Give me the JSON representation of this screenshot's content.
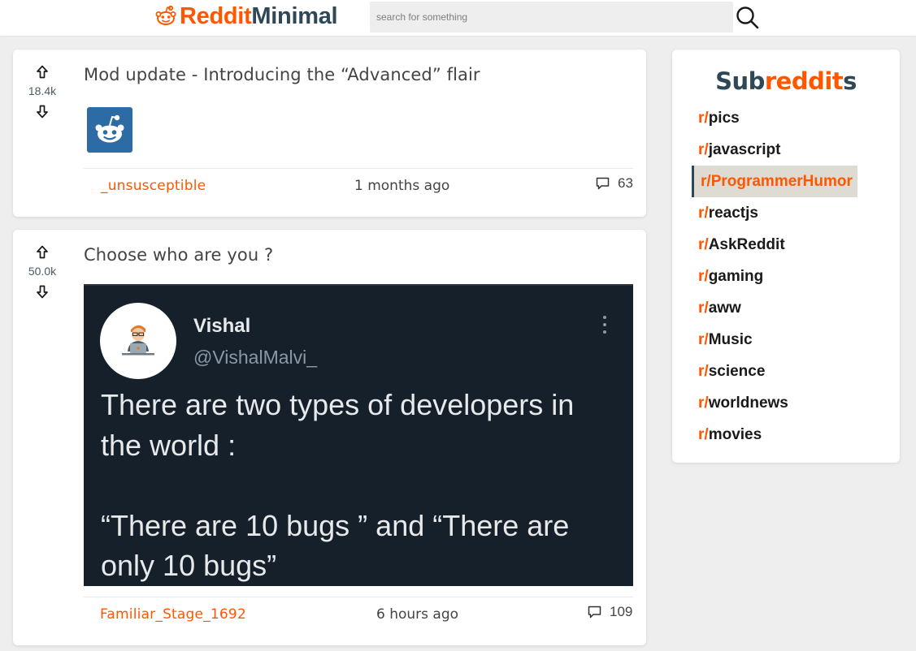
{
  "header": {
    "logo_part1": "Reddit",
    "logo_part2": "Minimal",
    "search_placeholder": "search for something"
  },
  "posts": [
    {
      "votes": "18.4k",
      "title": "Mod update - Introducing the “Advanced” flair",
      "author": "_unsusceptible",
      "time": "1 months ago",
      "comments": "63"
    },
    {
      "votes": "50.0k",
      "title": "Choose who are you ?",
      "author": "Familiar_Stage_1692",
      "time": "6 hours ago",
      "comments": "109",
      "tweet": {
        "name": "Vishal",
        "handle": "@VishalMalvi_",
        "line1": "There are two types of developers in",
        "line2": "the world :",
        "line3": "“There are 10 bugs ” and “There are",
        "line4": "only 10 bugs”"
      }
    }
  ],
  "sidebar": {
    "title_part1": "Sub",
    "title_part2": "reddit",
    "title_part3": "s",
    "prefix": "r/",
    "items": [
      "pics",
      "javascript",
      "ProgrammerHumor",
      "reactjs",
      "AskReddit",
      "gaming",
      "aww",
      "Music",
      "science",
      "worldnews",
      "movies"
    ],
    "active": "ProgrammerHumor"
  },
  "colors": {
    "brand_orange": "#ff5700",
    "brand_dark": "#2f4858",
    "active_bg": "#dedbd2",
    "tweet_bg": "#15202b"
  },
  "icons": {
    "logo": "reddit-alien-icon",
    "search": "search-icon",
    "upvote": "arrow-up-icon",
    "downvote": "arrow-down-icon",
    "comments": "comment-bubble-icon",
    "more": "more-vertical-icon"
  }
}
